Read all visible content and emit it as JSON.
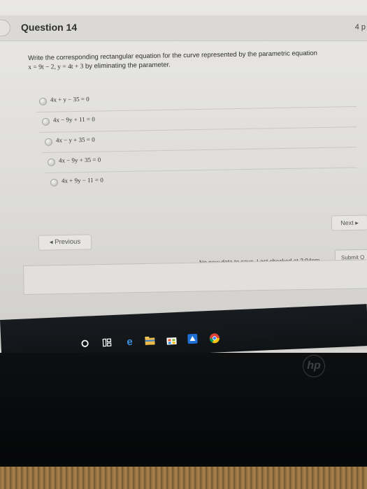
{
  "question": {
    "title": "Question 14",
    "points": "4 p",
    "prompt_line1": "Write the corresponding rectangular equation for the curve represented by the parametric equation",
    "prompt_eq": "x = 9t − 2, y = 4t + 3",
    "prompt_tail": " by eliminating the parameter."
  },
  "options": [
    {
      "label": "4x + y − 35 = 0"
    },
    {
      "label": "4x − 9y + 11 = 0"
    },
    {
      "label": "4x − y + 35 = 0"
    },
    {
      "label": "4x − 9y + 35 = 0"
    },
    {
      "label": "4x + 9y − 11 = 0"
    }
  ],
  "nav": {
    "next_label": "Next ▸",
    "previous_label": "◂ Previous"
  },
  "footer": {
    "save_status": "No new data to save. Last checked at 2:04pm",
    "submit_label": "Submit Q"
  },
  "taskbar": {
    "icons": [
      "search-circle-icon",
      "task-view-icon",
      "edge-icon",
      "file-explorer-icon",
      "store-icon",
      "app-blue-icon",
      "chrome-icon"
    ]
  },
  "monitor": {
    "brand": "hp"
  }
}
